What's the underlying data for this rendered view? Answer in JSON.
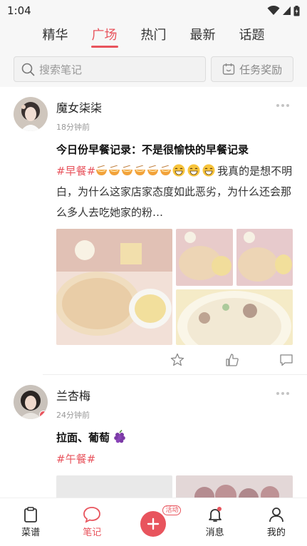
{
  "status": {
    "time": "1:04"
  },
  "tabs": [
    {
      "label": "精华",
      "active": false
    },
    {
      "label": "广场",
      "active": true
    },
    {
      "label": "热门",
      "active": false
    },
    {
      "label": "最新",
      "active": false
    },
    {
      "label": "话题",
      "active": false
    }
  ],
  "search": {
    "placeholder": "搜索笔记",
    "task_label": "任务奖励"
  },
  "posts": [
    {
      "author": "魔女柒柒",
      "time": "18分钟前",
      "title": "今日份早餐记录：不是很愉快的早餐记录",
      "tag": "#早餐#",
      "text_line1_tail": "我真的是想不",
      "text_rest": "明白，为什么这家店家态度如此恶劣，为什么还会那么多人去吃她家的粉…"
    },
    {
      "author": "兰杏梅",
      "time": "24分钟前",
      "title": "拉面、葡萄",
      "tag": "#午餐#"
    }
  ],
  "nav": [
    {
      "label": "菜谱",
      "icon": "clipboard-icon",
      "active": false
    },
    {
      "label": "笔记",
      "icon": "chat-bubble-icon",
      "active": true
    },
    {
      "label": "",
      "icon": "plus-icon",
      "badge": "活动"
    },
    {
      "label": "消息",
      "icon": "bell-icon",
      "active": false
    },
    {
      "label": "我的",
      "icon": "person-icon",
      "active": false
    }
  ],
  "colors": {
    "accent": "#e8545d"
  }
}
